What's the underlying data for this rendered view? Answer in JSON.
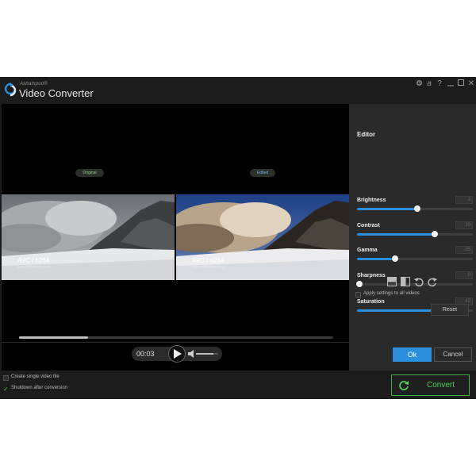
{
  "window": {
    "brand": "Ashampoo®",
    "title": "Video Converter",
    "buttons": [
      "settings-icon",
      "help-a-icon",
      "question-icon",
      "minimize-icon",
      "maximize-icon",
      "close-icon"
    ],
    "help_a": "a",
    "help_q": "?",
    "close": "✕"
  },
  "preview": {
    "original_label": "Original",
    "edited_label": "Edited",
    "watermark_line1": "AVC / h264",
    "watermark_line2": "www.h264info.com",
    "progress": 0.22
  },
  "controls": {
    "time": "00:03",
    "volume": 0.8
  },
  "editor": {
    "title": "Editor",
    "params": [
      {
        "label": "Brightness",
        "value": "3",
        "level": 0.52
      },
      {
        "label": "Contrast",
        "value": "20",
        "level": 0.67
      },
      {
        "label": "Gamma",
        "value": "-35",
        "level": 0.33
      },
      {
        "label": "Sharpness",
        "value": "0",
        "level": 0.02
      },
      {
        "label": "Saturation",
        "value": "42",
        "level": 0.88
      }
    ],
    "tools": [
      "split-horizontal-icon",
      "split-vertical-icon",
      "rotate-left-icon",
      "rotate-right-icon"
    ],
    "apply_all_label": "Apply settings to all videos",
    "reset_label": "Reset",
    "ok_label": "Ok",
    "cancel_label": "Cancel"
  },
  "bottom": {
    "single_file_label": "Create single video file",
    "single_file_checked": false,
    "shutdown_label": "Shutdown after conversion",
    "shutdown_checked": true,
    "convert_label": "Convert"
  },
  "colors": {
    "accent": "#2b8fe0",
    "convert_green": "#4fd05c",
    "background": "#1c1c1c",
    "panel": "#2a2a2a"
  }
}
